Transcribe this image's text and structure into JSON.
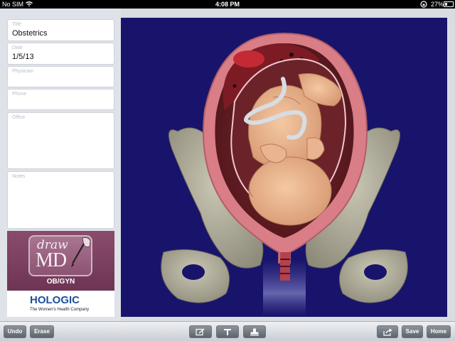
{
  "status_bar": {
    "carrier": "No SIM",
    "time": "4:08 PM",
    "battery": "27%",
    "battery_level": 0.27
  },
  "form": {
    "title": {
      "label": "Title",
      "value": "Obstetrics"
    },
    "date": {
      "label": "Date",
      "value": "1/5/13"
    },
    "physician": {
      "label": "Physician",
      "value": ""
    },
    "phone": {
      "label": "Phone",
      "value": ""
    },
    "office": {
      "label": "Office",
      "value": ""
    },
    "notes": {
      "label": "Notes",
      "value": ""
    }
  },
  "branding": {
    "app_logo_draw": "draw",
    "app_logo_md": "MD",
    "app_logo_sub": "OB/GYN",
    "company": "HOLOGIC",
    "company_tagline": "The Women's Health Company"
  },
  "toolbar": {
    "undo_label": "Undo",
    "erase_label": "Erase",
    "save_label": "Save",
    "home_label": "Home",
    "icons": [
      "edit-icon",
      "text-icon",
      "stamp-icon",
      "share-icon"
    ]
  },
  "colors": {
    "canvas_bg": "#18146b",
    "logo_panel": "#7a3d5f",
    "hologic_blue": "#1d4f9c"
  }
}
